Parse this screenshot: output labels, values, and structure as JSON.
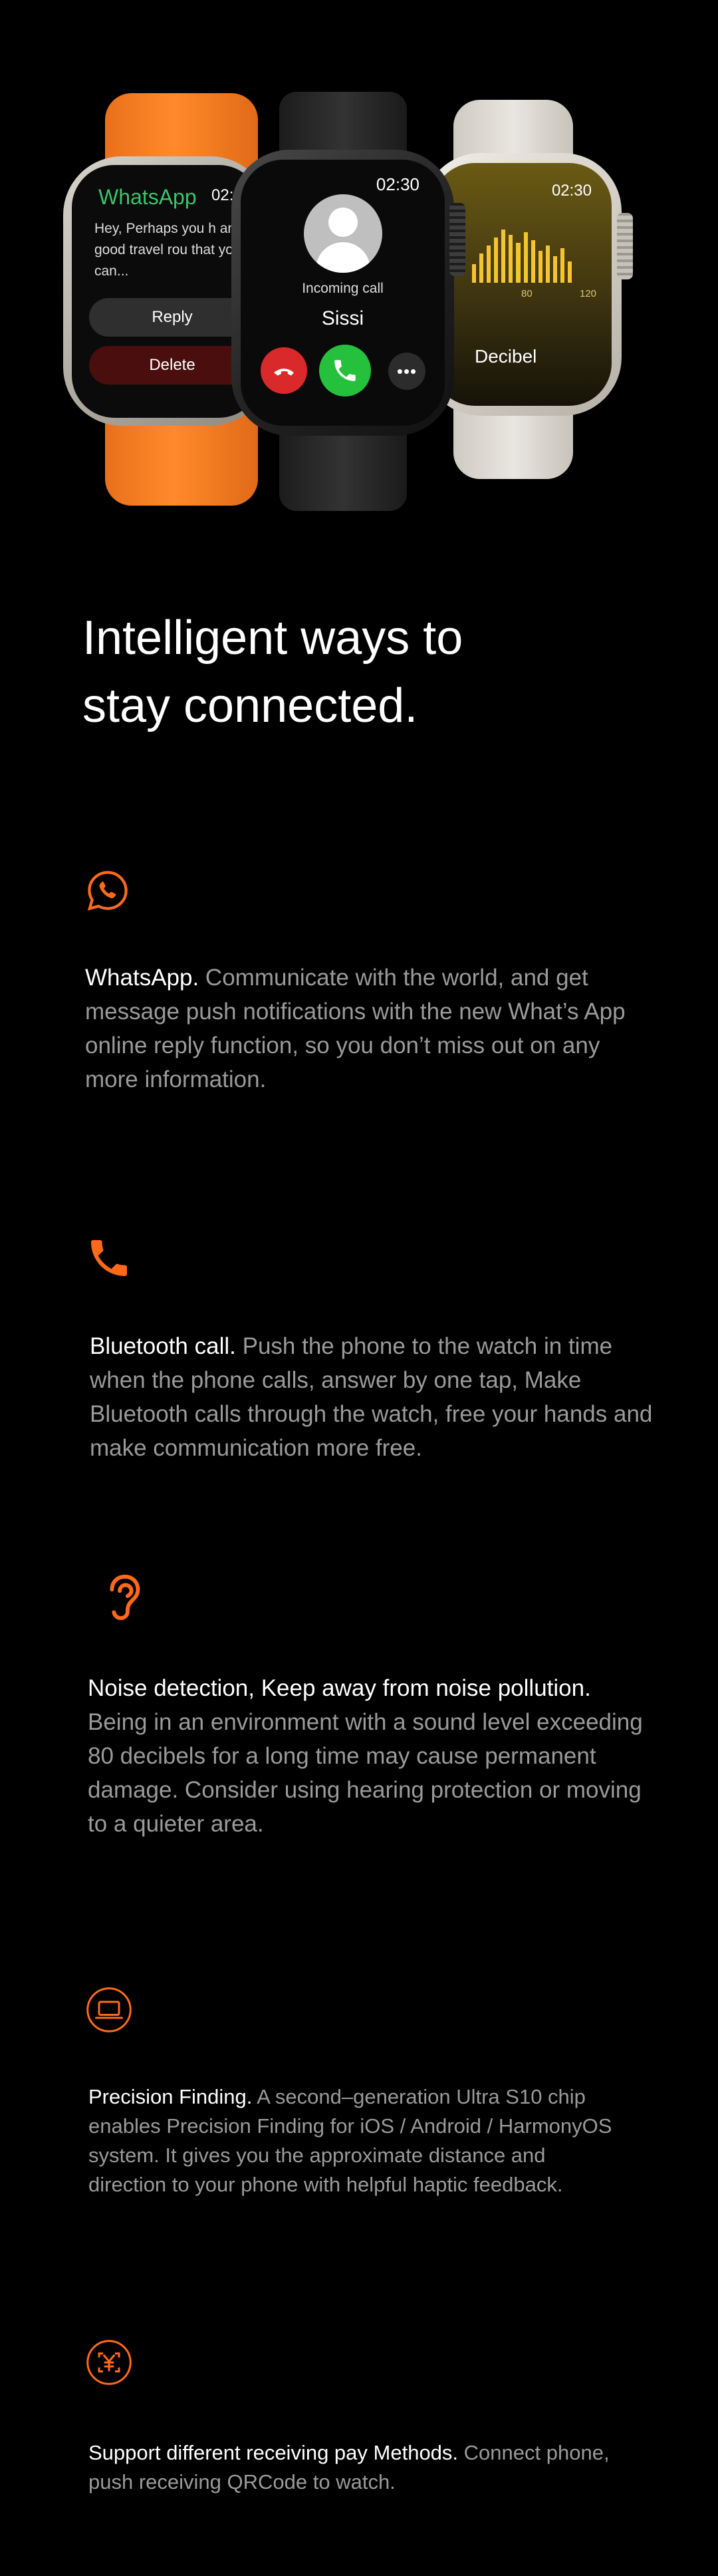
{
  "hero": {
    "left_watch": {
      "app_title": "WhatsApp",
      "time": "02:",
      "message": "Hey, Perhaps you h any good travel rou that you can...",
      "reply_label": "Reply",
      "delete_label": "Delete"
    },
    "center_watch": {
      "time": "02:30",
      "status": "Incoming call",
      "caller": "Sissi",
      "more_label": "•••"
    },
    "right_watch": {
      "time": "02:30",
      "tick_80": "80",
      "tick_120": "120",
      "label": "Decibel",
      "level_bars": [
        0.35,
        0.55,
        0.7,
        0.85,
        1.0,
        0.9,
        0.75,
        0.95,
        0.8,
        0.6,
        0.7,
        0.5,
        0.65,
        0.4
      ]
    }
  },
  "headline": {
    "line1": "Intelligent ways to",
    "line2": "stay connected."
  },
  "features": [
    {
      "icon": "whatsapp-icon",
      "lead": "WhatsApp.",
      "body": " Communicate with the world, and get message push notifications with the new What’s App online reply function, so you don’t miss out on any more information."
    },
    {
      "icon": "phone-icon",
      "lead": "Bluetooth call.",
      "body": " Push the phone to the watch in time when the phone calls, answer by one tap, Make Bluetooth calls through the watch, free your hands and make communication more free."
    },
    {
      "icon": "ear-icon",
      "lead": "Noise detection, Keep away from noise pollution.",
      "body": " Being in an environment with a sound level exceeding 80 decibels for a long time may cause permanent damage. Consider using hearing protection or moving to a quieter area."
    },
    {
      "icon": "laptop-icon",
      "lead": "Precision Finding.",
      "body": " A second–generation Ultra S10 chip enables Precision Finding for iOS / Android / HarmonyOS system. It gives you the approximate distance and direction to your phone with helpful haptic feedback."
    },
    {
      "icon": "yuan-scan-icon",
      "lead": "Support different receiving pay Methods.",
      "body": " Connect phone, push receiving QRCode to watch."
    }
  ],
  "colors": {
    "background": "#000000",
    "accent": "#ff6a1a",
    "body_text": "#9a9a9a",
    "whatsapp_green": "#39c46b",
    "accept_green": "#25c13d",
    "decline_red": "#d9292b",
    "decibel_yellow": "#f4c531"
  }
}
